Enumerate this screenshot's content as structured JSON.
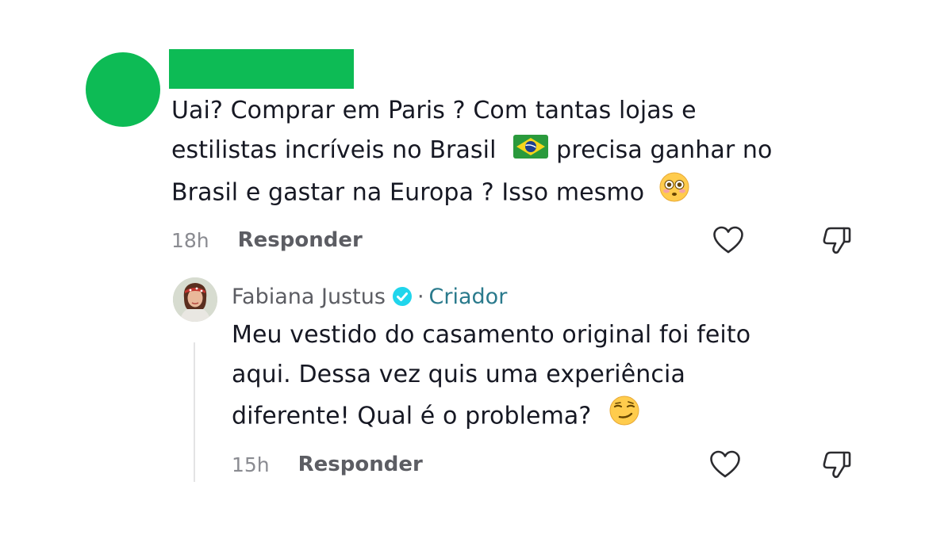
{
  "comment": {
    "lines": [
      "Uai? Comprar em Paris ? Com tantas lojas e",
      "estilistas incríveis no Brasil",
      "precisa ganhar no",
      "Brasil e gastar na Europa ? Isso mesmo"
    ],
    "time": "18h",
    "reply_label": "Responder",
    "icons": {
      "flag": "brazil-flag-emoji",
      "emoji": "flushed-face-emoji",
      "like": "heart-icon",
      "dislike": "thumbs-down-icon"
    }
  },
  "reply": {
    "author": "Fabiana Justus",
    "separator": "·",
    "badge": "Criador",
    "lines": [
      "Meu vestido do casamento original foi feito",
      "aqui. Dessa vez quis uma experiência",
      "diferente! Qual é o problema?"
    ],
    "time": "15h",
    "reply_label": "Responder",
    "icons": {
      "verified": "verified-badge-icon",
      "emoji": "smirking-face-emoji",
      "like": "heart-icon",
      "dislike": "thumbs-down-icon"
    }
  },
  "colors": {
    "redaction": "#0dbb55",
    "text": "#161823",
    "muted": "#8a8b91",
    "verified": "#20d5ec",
    "creator": "#2a7a8c"
  }
}
